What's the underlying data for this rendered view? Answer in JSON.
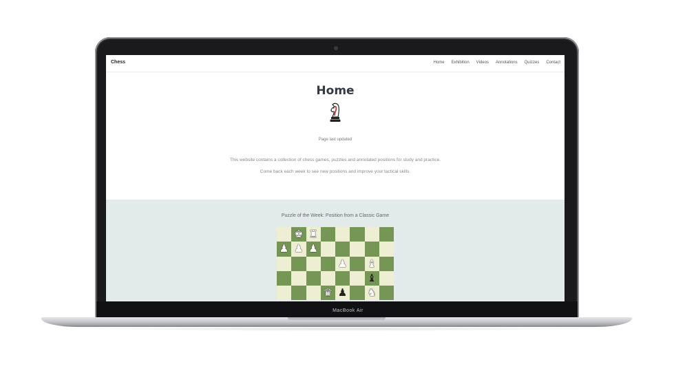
{
  "device": {
    "label": "MacBook Air"
  },
  "site": {
    "brand": "Chess",
    "nav": [
      "Home",
      "Exhibition",
      "Videos",
      "Annotations",
      "Quizzes",
      "Contact"
    ],
    "hero": {
      "title": "Home",
      "last_updated": "Page last updated",
      "intro_line1": "This website contains a collection of chess games, puzzles and annotated positions for study and practice.",
      "intro_line2": "Come back each week to see new positions and improve your tactical skills."
    },
    "puzzle": {
      "title": "Puzzle of the Week: Position from a Classic Game",
      "board": [
        [
          "",
          "wK",
          "wR",
          "",
          "",
          "",
          "",
          ""
        ],
        [
          "wP",
          "wP",
          "wP",
          "",
          "",
          "",
          "",
          ""
        ],
        [
          "",
          "",
          "",
          "",
          "wP",
          "",
          "wB",
          ""
        ],
        [
          "",
          "",
          "",
          "",
          "",
          "",
          "bB",
          ""
        ],
        [
          "",
          "",
          "",
          "wQ",
          "bP",
          "",
          "wN",
          ""
        ]
      ]
    }
  },
  "colors": {
    "light_square": "#eeeed2",
    "dark_square": "#769656",
    "section_bg": "#e2eaea",
    "title": "#333a45"
  },
  "icons": {
    "hero": "chess-knight-icon"
  }
}
